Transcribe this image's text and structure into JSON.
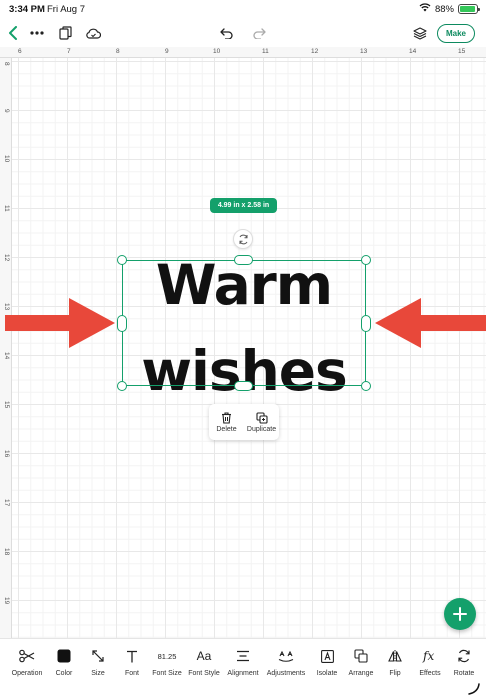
{
  "status_bar": {
    "time": "3:34 PM",
    "date": "Fri Aug 7",
    "battery": "88%"
  },
  "toolbar": {
    "back_icon": "chevron-left-icon",
    "more_icon": "ellipsis-icon",
    "make_label": "Make"
  },
  "ruler": {
    "x_labels": [
      "6",
      "7",
      "8",
      "9",
      "10",
      "11",
      "12",
      "13",
      "14",
      "15"
    ],
    "y_labels": [
      "8",
      "9",
      "10",
      "11",
      "12",
      "13",
      "14",
      "15",
      "16",
      "17",
      "18",
      "19"
    ]
  },
  "canvas": {
    "size_badge": "4.99 in x 2.58 in",
    "text_line1": "Warm",
    "text_line2": "wishes"
  },
  "context_menu": {
    "delete_label": "Delete",
    "duplicate_label": "Duplicate"
  },
  "bottom_bar": {
    "operation": "Operation",
    "color": "Color",
    "size": "Size",
    "font": "Font",
    "font_size_value": "81.25",
    "font_size": "Font Size",
    "font_style_glyph": "Aa",
    "font_style": "Font Style",
    "alignment": "Alignment",
    "adjustments": "Adjustments",
    "isolate": "Isolate",
    "arrange": "Arrange",
    "flip": "Flip",
    "effects": "Effects",
    "rotate": "Rotate"
  },
  "colors": {
    "accent": "#14a06b",
    "arrow": "#e8483a"
  }
}
